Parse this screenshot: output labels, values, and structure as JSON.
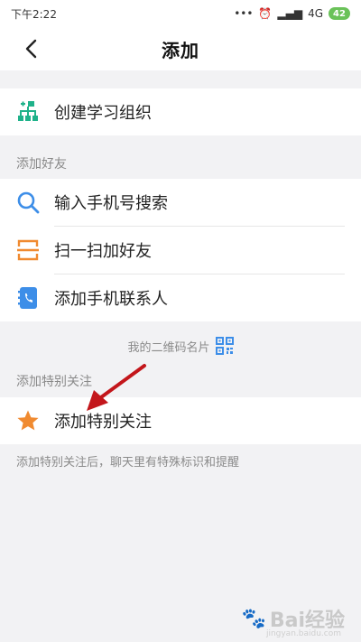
{
  "statusbar": {
    "time": "下午2:22",
    "signal": "4G",
    "battery": "42"
  },
  "header": {
    "title": "添加"
  },
  "create_group": {
    "label": "创建学习组织",
    "icon": "org-tree-icon"
  },
  "friends_section": {
    "title": "添加好友",
    "items": [
      {
        "label": "输入手机号搜索",
        "icon": "search-icon"
      },
      {
        "label": "扫一扫加好友",
        "icon": "scan-icon"
      },
      {
        "label": "添加手机联系人",
        "icon": "contacts-icon"
      }
    ]
  },
  "qr_link": {
    "label": "我的二维码名片",
    "icon": "qrcode-icon"
  },
  "special_section": {
    "title": "添加特别关注",
    "item_label": "添加特别关注",
    "icon": "star-icon",
    "hint": "添加特别关注后，聊天里有特殊标识和提醒"
  },
  "watermark": {
    "text": "Bai经验",
    "sub": "jingyan.baidu.com"
  },
  "colors": {
    "accent_green": "#1fb28a",
    "accent_blue": "#3d8ee8",
    "accent_orange": "#f08a30",
    "annotation_red": "#c3161b"
  }
}
